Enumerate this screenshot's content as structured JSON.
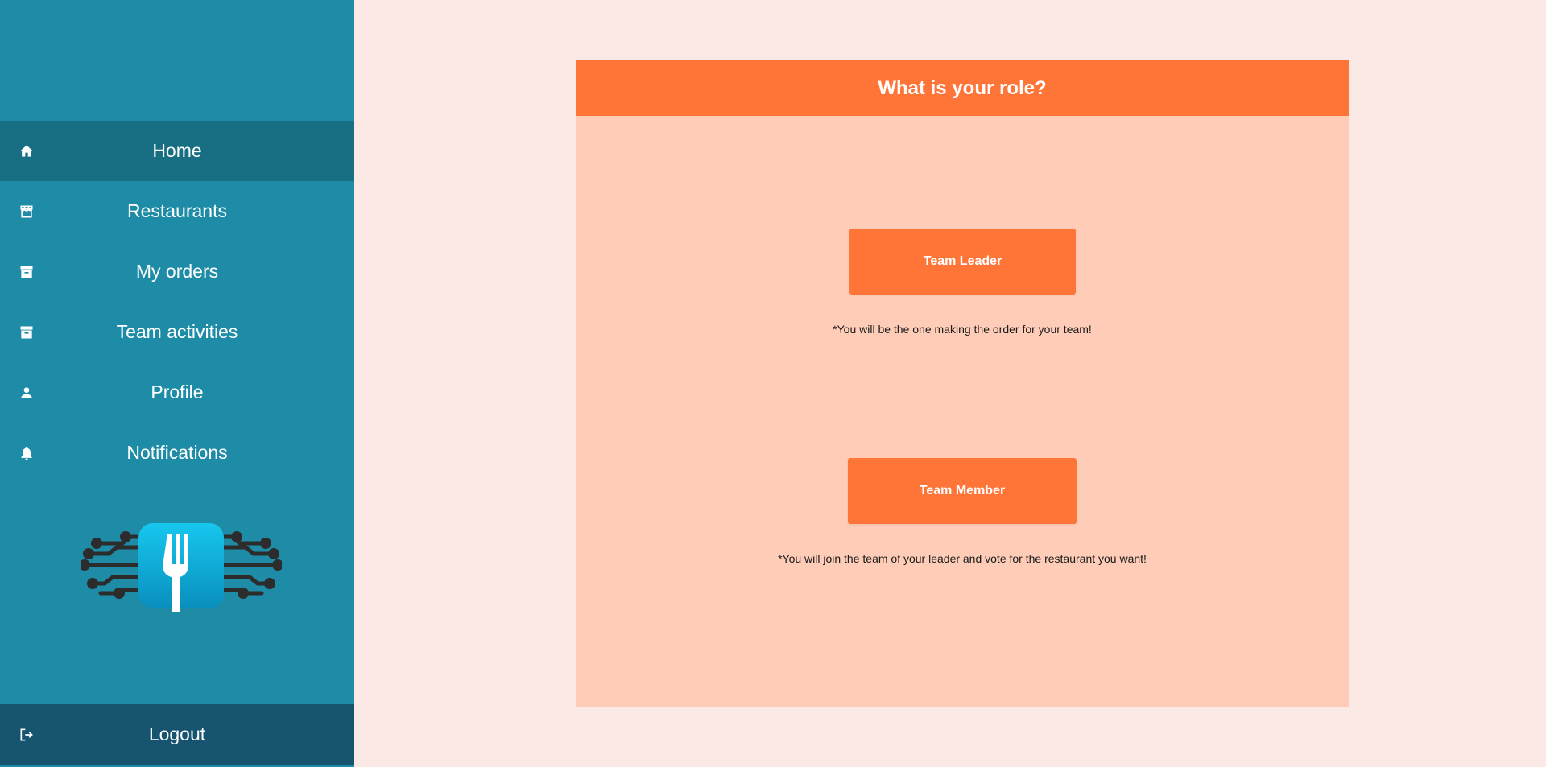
{
  "sidebar": {
    "items": [
      {
        "label": "Home",
        "icon": "home-icon"
      },
      {
        "label": "Restaurants",
        "icon": "storefront-icon"
      },
      {
        "label": "My orders",
        "icon": "archive-icon"
      },
      {
        "label": "Team activities",
        "icon": "archive-icon"
      },
      {
        "label": "Profile",
        "icon": "person-icon"
      },
      {
        "label": "Notifications",
        "icon": "bell-icon"
      }
    ],
    "active_item": "Home",
    "logout_label": "Logout",
    "logo_icon": "fork-circuit-logo"
  },
  "main": {
    "title": "What is your role?",
    "leader_button": "Team Leader",
    "leader_note": "*You will be the one making the order for your team!",
    "member_button": "Team Member",
    "member_note": "*You will join the team of your leader and vote for the restaurant you want!"
  },
  "colors": {
    "sidebar": "#1e8ca6",
    "sidebar_active": "#186e82",
    "logout": "#17546f",
    "accent": "#ff7538",
    "card": "#ffcdb7",
    "page": "#fbe9e5"
  }
}
